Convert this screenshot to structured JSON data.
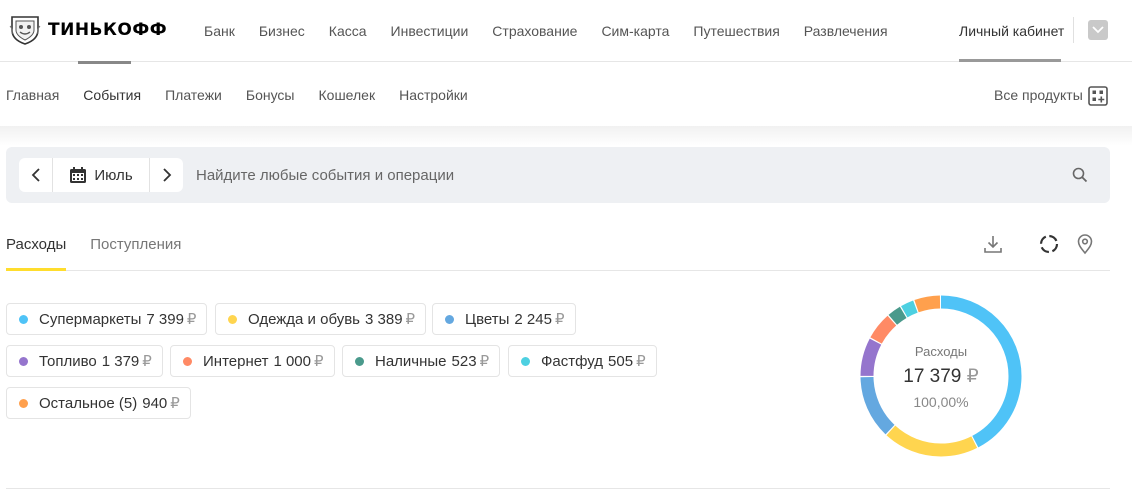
{
  "header": {
    "logo_text": "ТИНЬКОФФ",
    "nav": [
      "Банк",
      "Бизнес",
      "Касса",
      "Инвестиции",
      "Страхование",
      "Сим-карта",
      "Путешествия",
      "Развлечения"
    ],
    "account_label": "Личный кабинет"
  },
  "subnav": {
    "items": [
      "Главная",
      "События",
      "Платежи",
      "Бонусы",
      "Кошелек",
      "Настройки"
    ],
    "active": "События",
    "all_products_label": "Все продукты"
  },
  "search": {
    "month": "Июль",
    "placeholder": "Найдите любые события и операции"
  },
  "tabs": {
    "items": [
      "Расходы",
      "Поступления"
    ],
    "active": "Расходы"
  },
  "currency": "₽",
  "categories": [
    {
      "name": "Супермаркеты",
      "amount": "7 399",
      "value": 7399,
      "color": "#4fc3f7"
    },
    {
      "name": "Одежда и обувь",
      "amount": "3 389",
      "value": 3389,
      "color": "#ffd54f"
    },
    {
      "name": "Цветы",
      "amount": "2 245",
      "value": 2245,
      "color": "#64a8e0"
    },
    {
      "name": "Топливо",
      "amount": "1 379",
      "value": 1379,
      "color": "#9575cd"
    },
    {
      "name": "Интернет",
      "amount": "1 000",
      "value": 1000,
      "color": "#ff8a65"
    },
    {
      "name": "Наличные",
      "amount": "523",
      "value": 523,
      "color": "#4a9a8c"
    },
    {
      "name": "Фастфуд",
      "amount": "505",
      "value": 505,
      "color": "#4dd0e1"
    },
    {
      "name": "Остальное (5)",
      "amount": "940",
      "value": 940,
      "color": "#ffa04d"
    }
  ],
  "donut": {
    "label": "Расходы",
    "total": "17 379",
    "percent": "100,00%"
  }
}
